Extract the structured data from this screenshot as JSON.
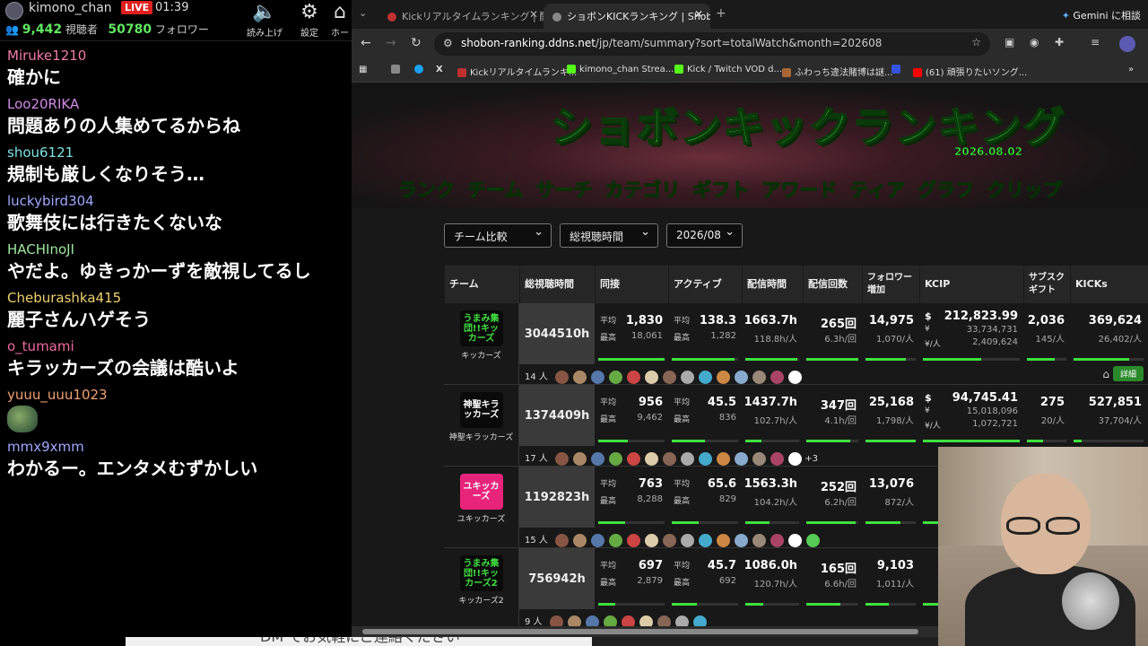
{
  "stream": {
    "username": "kimono_chan",
    "live_badge": "LIVE",
    "elapsed": "01:39",
    "viewers": "9,442",
    "viewers_label": "視聴者",
    "followers": "50780",
    "followers_label": "フォロワー",
    "tools": [
      "読み上げ",
      "設定",
      "ホー"
    ]
  },
  "chat": [
    {
      "user": "Miruke1210",
      "color": "#f07ba8",
      "text": "確かに"
    },
    {
      "user": "Loo20RIKA",
      "color": "#d08ae6",
      "text": "問題ありの人集めてるからね"
    },
    {
      "user": "shou6121",
      "color": "#7ee0e0",
      "text": "規制も厳しくなりそう…"
    },
    {
      "user": "luckybird304",
      "color": "#9fa8ff",
      "text": "歌舞伎には行きたくないな"
    },
    {
      "user": "HACHInoJI",
      "color": "#9fe89f",
      "text": "やだよ。ゆきっかーずを敵視してるし"
    },
    {
      "user": "Cheburashka415",
      "color": "#f0d070",
      "text": "麗子さんハゲそう"
    },
    {
      "user": "o_tumami",
      "color": "#f06aa0",
      "text": "キラッカーズの会議は酷いよ"
    },
    {
      "user": "yuuu_uuu1023",
      "color": "#f0a070",
      "text": ""
    },
    {
      "user": "mmx9xmm",
      "color": "#9fa8ff",
      "text": "わかるー。エンタメむずかしい"
    }
  ],
  "browser": {
    "tabs": [
      {
        "title": "Kickリアルタイムランキング | 配信者",
        "color": "#c03030"
      },
      {
        "title": "ショボンKICKランキング | Shobon K",
        "color": "#888888"
      }
    ],
    "new_tab": "+",
    "gemini": "Gemini に相談",
    "url_host": "shobon-ranking.ddns.net",
    "url_path": "/jp/team/summary?sort=totalWatch&month=202608",
    "bookmarks": [
      {
        "label": "",
        "color": "#888888"
      },
      {
        "label": "",
        "color": "#1da1f2"
      },
      {
        "label": "X",
        "color": "#000000"
      },
      {
        "label": "Kickリアルタイムランキ...",
        "color": "#c03030"
      },
      {
        "label": "kimono_chan Strea...",
        "color": "#53fc18"
      },
      {
        "label": "Kick / Twitch VOD d...",
        "color": "#53fc18"
      },
      {
        "label": "ふわっち違法賭博は謎...",
        "color": "#aa6633"
      },
      {
        "label": "",
        "color": "#3355dd"
      },
      {
        "label": "(61) 頑張りたいソング...",
        "color": "#ff0000"
      }
    ]
  },
  "site": {
    "logo": "ショボンキックランキング",
    "date": "2026.08.02",
    "menu": [
      "ランク",
      "チーム",
      "サーチ",
      "カテゴリ",
      "ギフト",
      "アワード",
      "ティア",
      "グラフ",
      "クリップ"
    ],
    "active_menu": "チーム",
    "selects": [
      "チーム比較",
      "総視聴時間",
      "2026/08"
    ]
  },
  "table": {
    "headers": [
      "チーム",
      "総視聴時間",
      "同接",
      "アクティブ",
      "配信時間",
      "配信回数",
      "フォロワー増加",
      "KCIP",
      "サブスクギフト",
      "KICKs"
    ],
    "avg_label": "平均",
    "max_label": "最高",
    "detail_label": "詳細",
    "rows": [
      {
        "logo": "うまみ集団!!キッカーズ",
        "logo_bg": "#0a0a0a",
        "logo_fg": "#3fe03f",
        "name": "キッカーズ",
        "total": "3044510h",
        "ccu_avg": "1,830",
        "ccu_max": "18,061",
        "act_avg": "138.3",
        "act_max": "1,282",
        "hours": "1663.7h",
        "hours_sub": "118.8h/人",
        "count": "265回",
        "count_sub": "6.3h/回",
        "follow": "14,975",
        "follow_sub": "1,070/人",
        "kcip": "212,823.99",
        "kcip_yen": "33,734,731",
        "kcip_per": "2,409,624",
        "subs": "2,036",
        "subs_sub": "145/人",
        "kicks": "369,624",
        "kicks_sub": "26,402/人",
        "members": "14 人",
        "member_count": 14,
        "more": "",
        "bar": [
          1.0,
          0.95,
          0.97,
          1.0,
          0.8,
          0.6,
          0.7,
          0.8,
          1.0
        ]
      },
      {
        "logo": "神聖キラッカーズ",
        "logo_bg": "#0a0a0a",
        "logo_fg": "#ffffff",
        "name": "神聖キラッカーズ",
        "total": "1374409h",
        "ccu_avg": "956",
        "ccu_max": "9,462",
        "act_avg": "45.5",
        "act_max": "836",
        "hours": "1437.7h",
        "hours_sub": "102.7h/人",
        "count": "347回",
        "count_sub": "4.1h/回",
        "follow": "25,168",
        "follow_sub": "1,798/人",
        "kcip": "94,745.41",
        "kcip_yen": "15,018,096",
        "kcip_per": "1,072,721",
        "subs": "275",
        "subs_sub": "20/人",
        "kicks": "527,851",
        "kicks_sub": "37,704/人",
        "members": "17 人",
        "member_count": 14,
        "more": "+3",
        "bar": [
          0.45,
          0.5,
          0.3,
          0.85,
          1.0,
          1.0,
          0.4,
          0.12,
          1.0
        ]
      },
      {
        "logo": "ユキッカーズ",
        "logo_bg": "#e8237a",
        "logo_fg": "#ffffff",
        "name": "ユキッカーズ",
        "total": "1192823h",
        "ccu_avg": "763",
        "ccu_max": "8,288",
        "act_avg": "65.6",
        "act_max": "829",
        "hours": "1563.3h",
        "hours_sub": "104.2h/人",
        "count": "252回",
        "count_sub": "6.2h/回",
        "follow": "13,076",
        "follow_sub": "872/人",
        "kcip": "",
        "kcip_yen": "",
        "kcip_per": "",
        "subs": "",
        "subs_sub": "",
        "kicks": "",
        "kicks_sub": "",
        "members": "15 人",
        "member_count": 15,
        "more": "",
        "bar": [
          0.4,
          0.4,
          0.45,
          0.94,
          0.7,
          0.5,
          0.0,
          0.0,
          0.0
        ]
      },
      {
        "logo": "うまみ集団!!キッカーズ2",
        "logo_bg": "#0a0a0a",
        "logo_fg": "#3fe03f",
        "name": "キッカーズ2",
        "total": "756942h",
        "ccu_avg": "697",
        "ccu_max": "2,879",
        "act_avg": "45.7",
        "act_max": "692",
        "hours": "1086.0h",
        "hours_sub": "120.7h/人",
        "count": "165回",
        "count_sub": "6.6h/回",
        "follow": "9,103",
        "follow_sub": "1,011/人",
        "kcip": "",
        "kcip_yen": "",
        "kcip_per": "",
        "subs": "",
        "subs_sub": "",
        "kicks": "",
        "kicks_sub": "",
        "members": "9 人",
        "member_count": 9,
        "more": "",
        "bar": [
          0.25,
          0.38,
          0.33,
          0.65,
          0.47,
          0.5,
          0.0,
          0.0,
          0.0
        ]
      }
    ]
  },
  "banner_text": "DM でお気軽にご連絡ください"
}
